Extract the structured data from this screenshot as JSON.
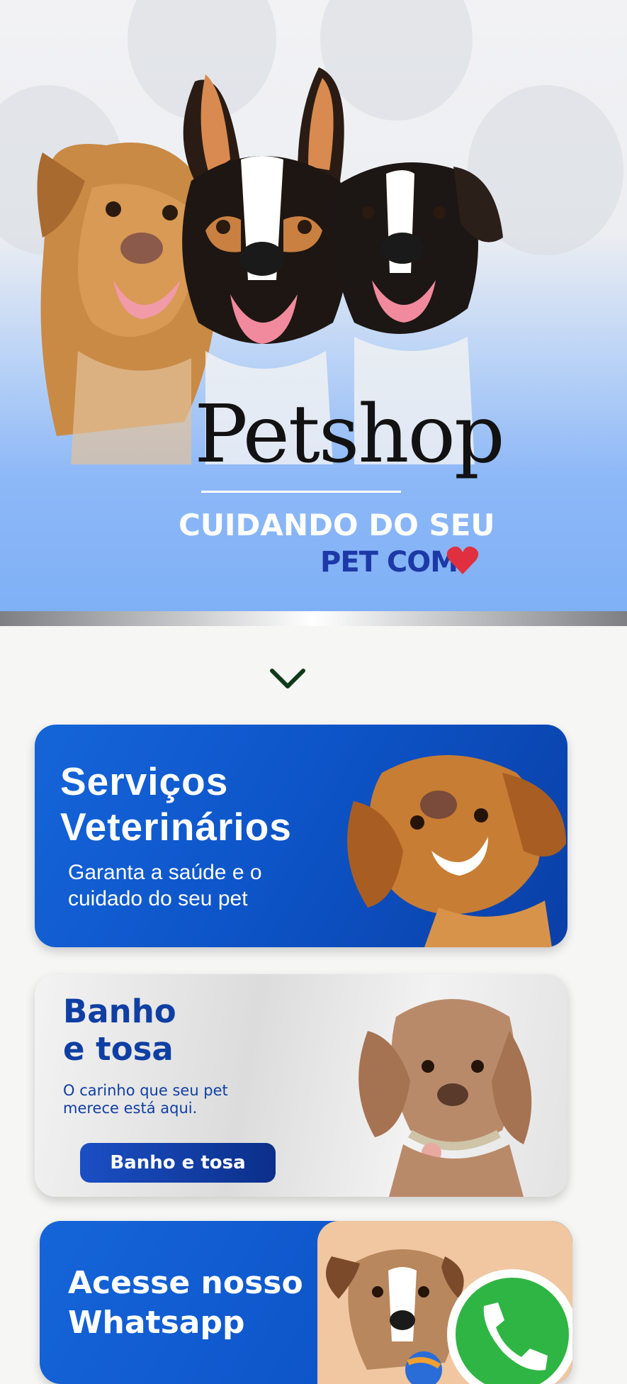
{
  "hero": {
    "title": "Petshop",
    "subtitle_line1": "CUIDANDO DO SEU",
    "subtitle_line2": "PET COM",
    "heart_icon": "heart-icon"
  },
  "scroll_indicator": {
    "icon": "chevron-down-icon"
  },
  "cards": {
    "vet": {
      "title_line1": "Serviços",
      "title_line2": "Veterinários",
      "subtitle": "Garanta a saúde e o cuidado do seu pet"
    },
    "grooming": {
      "title_line1": "Banho",
      "title_line2": "e tosa",
      "subtitle": "O carinho que seu pet merece está aqui.",
      "button_label": "Banho e tosa"
    },
    "whatsapp": {
      "title_line1": "Acesse nosso",
      "title_line2": "Whatsapp",
      "icon": "whatsapp-icon"
    }
  },
  "colors": {
    "primary_blue": "#0d55c9",
    "dark_blue": "#0f3fa3",
    "heart_red": "#e0303f",
    "whatsapp_green": "#2fb543",
    "chevron_green": "#0f3a1a"
  }
}
